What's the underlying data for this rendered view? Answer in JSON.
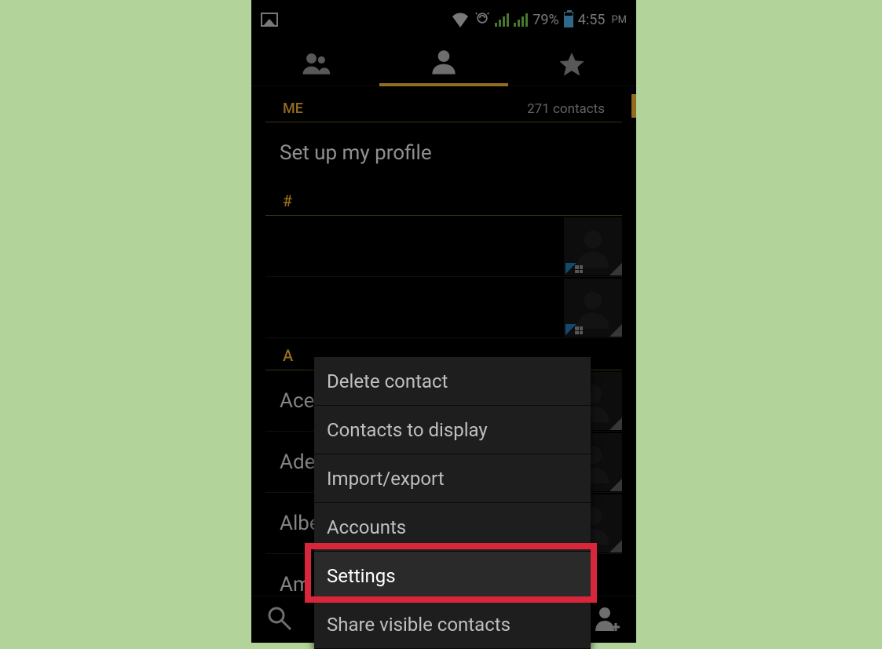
{
  "statusbar": {
    "battery_pct": "79%",
    "time": "4:55",
    "ampm": "PM"
  },
  "header": {
    "me_label": "ME",
    "contacts_count": "271 contacts",
    "profile_setup": "Set up my profile"
  },
  "sections": {
    "hash": "#",
    "a": "A"
  },
  "contacts": {
    "a0": "Ace",
    "a1": "Ade",
    "a2": "Albe",
    "a3": "Am"
  },
  "menu": {
    "items": [
      "Delete contact",
      "Contacts to display",
      "Import/export",
      "Accounts",
      "Settings",
      "Share visible contacts"
    ]
  }
}
